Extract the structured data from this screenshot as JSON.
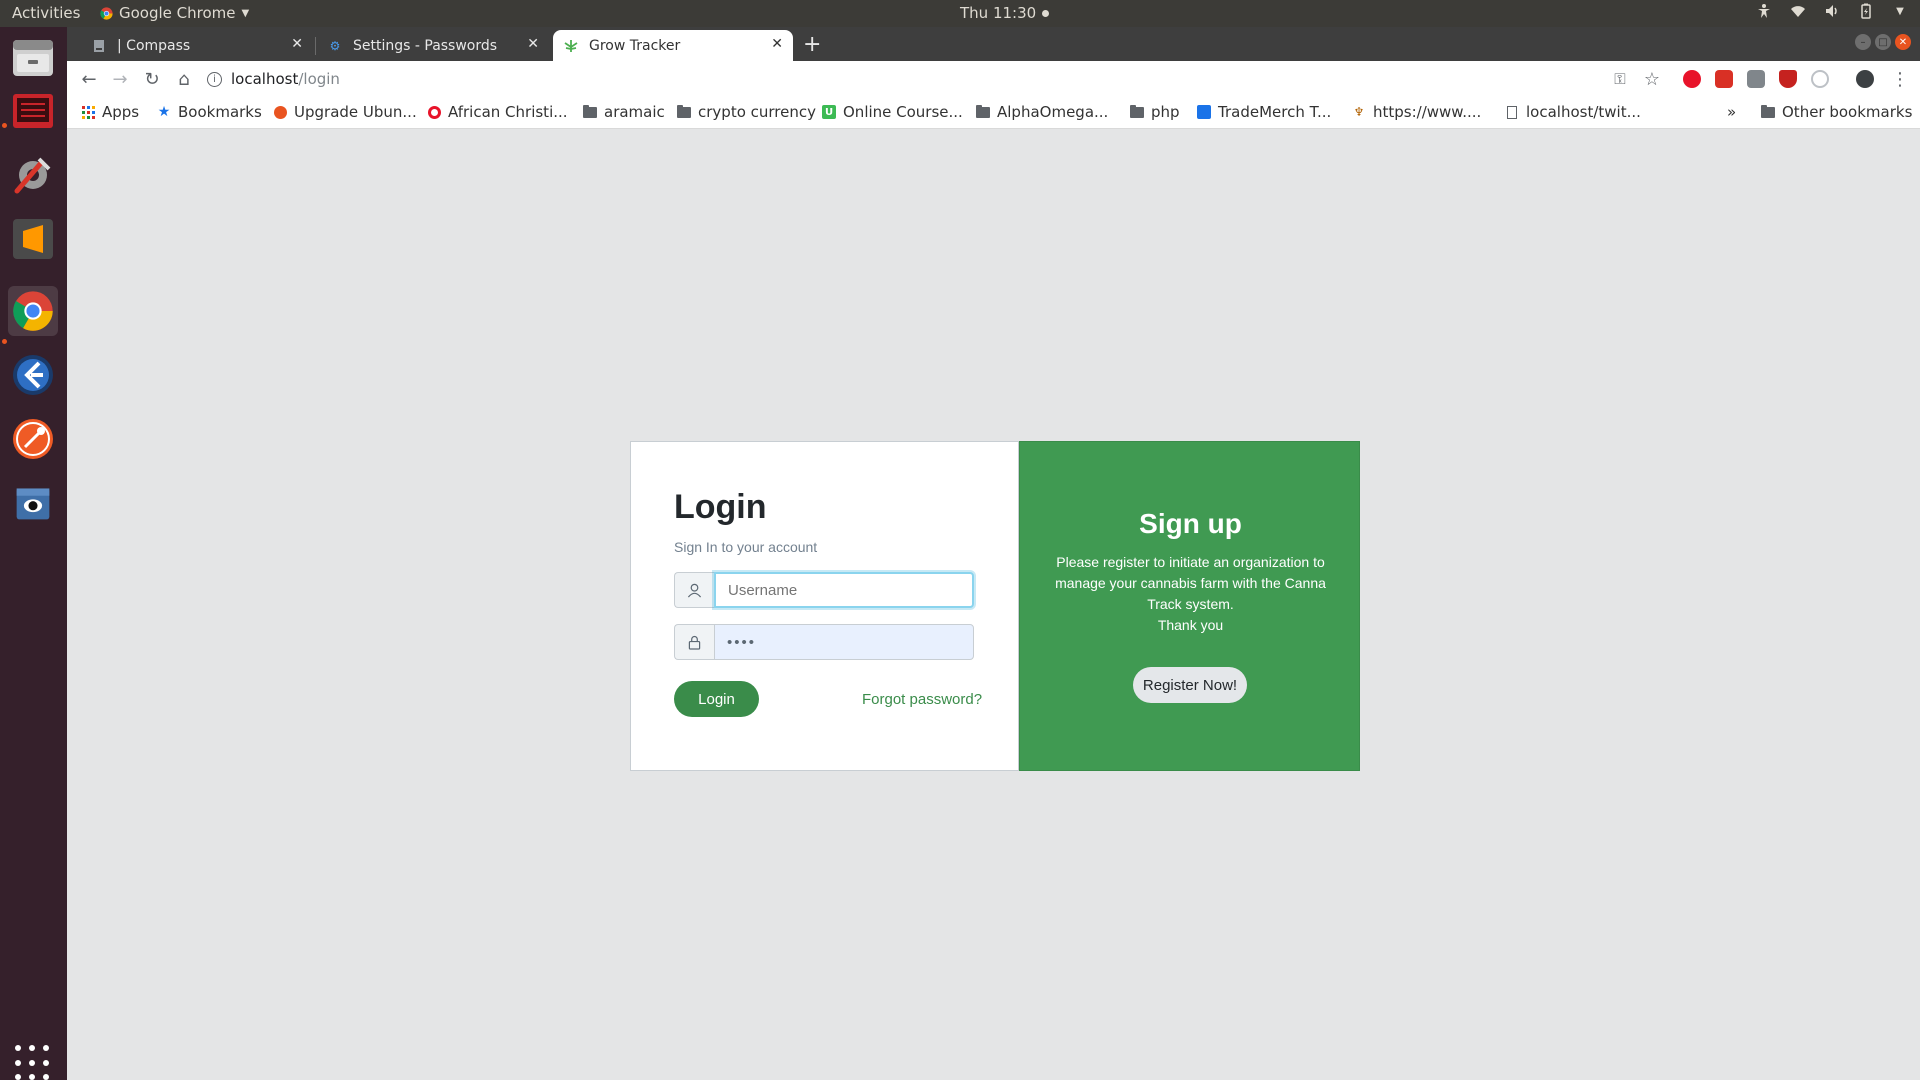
{
  "topbar": {
    "activities": "Activities",
    "app_name": "Google Chrome",
    "clock": "Thu 11:30"
  },
  "dock": {
    "items": [
      "file-manager",
      "terminal",
      "settings-tools",
      "sublime-text",
      "chrome",
      "code-editor",
      "postman",
      "eye-app"
    ]
  },
  "tabs": [
    {
      "title": "| Compass",
      "icon": "page-icon"
    },
    {
      "title": "Settings - Passwords",
      "icon": "settings-gear-icon"
    },
    {
      "title": "Grow Tracker",
      "icon": "leaf-icon",
      "active": true
    }
  ],
  "address_bar": {
    "host": "localhost",
    "path": "/login"
  },
  "bookmarks": [
    {
      "label": "Apps",
      "icon": "apps-grid-icon"
    },
    {
      "label": "Bookmarks",
      "icon": "star-icon"
    },
    {
      "label": "Upgrade Ubun...",
      "icon": "ubuntu-icon"
    },
    {
      "label": "African Christi...",
      "icon": "opera-icon"
    },
    {
      "label": "aramaic",
      "icon": "folder-icon"
    },
    {
      "label": "crypto currency",
      "icon": "folder-icon"
    },
    {
      "label": "Online Course...",
      "icon": "udemy-icon"
    },
    {
      "label": "AlphaOmega...",
      "icon": "folder-icon"
    },
    {
      "label": "php",
      "icon": "folder-icon"
    },
    {
      "label": "TradeMerch T...",
      "icon": "doc-icon"
    },
    {
      "label": "https://www....",
      "icon": "trophy-icon"
    },
    {
      "label": "localhost/twit...",
      "icon": "page-icon"
    }
  ],
  "bookmarks_overflow": "»",
  "other_bookmarks": "Other bookmarks",
  "login": {
    "title": "Login",
    "subtitle": "Sign In to your account",
    "username_placeholder": "Username",
    "password_value": "••••",
    "button": "Login",
    "forgot": "Forgot password?"
  },
  "signup": {
    "title": "Sign up",
    "text_line1": "Please register to initiate an organization to",
    "text_line2": "manage your cannabis farm with the Canna",
    "text_line3": "Track system.",
    "text_line4": "Thank you",
    "button": "Register Now!"
  },
  "colors": {
    "brand_green": "#409a52",
    "button_green": "#3a8c4a",
    "ubuntu_orange": "#e95420"
  }
}
